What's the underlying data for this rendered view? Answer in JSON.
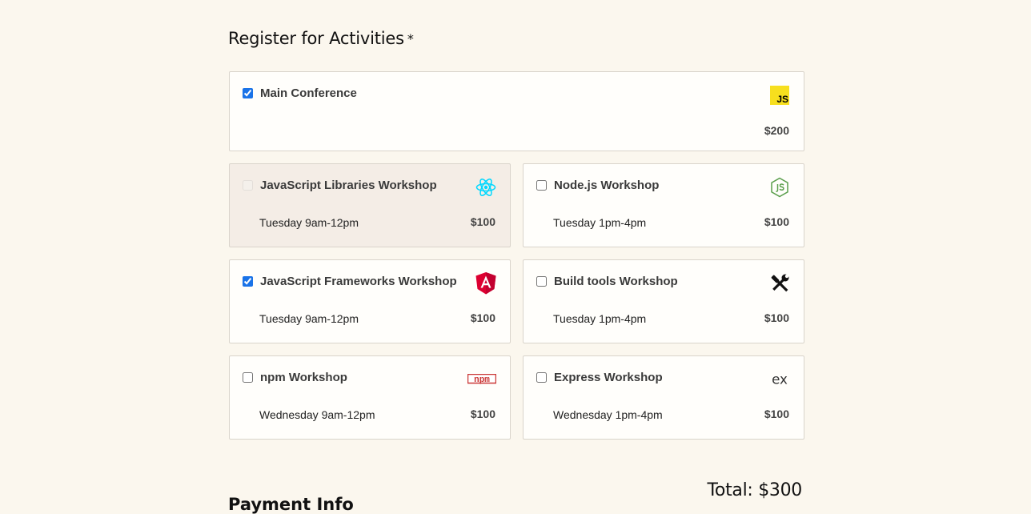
{
  "section": {
    "title": "Register for Activities",
    "required_mark": "*"
  },
  "activities": [
    {
      "name": "Main Conference",
      "time": "",
      "price": "$200",
      "checked": true,
      "disabled": false,
      "icon": "javascript-icon",
      "icon_text": "JS",
      "color": "#f7df1e"
    },
    {
      "name": "JavaScript Libraries Workshop",
      "time": "Tuesday 9am-12pm",
      "price": "$100",
      "checked": false,
      "disabled": true,
      "icon": "react-icon",
      "color": "#00d8ff"
    },
    {
      "name": "Node.js Workshop",
      "time": "Tuesday 1pm-4pm",
      "price": "$100",
      "checked": false,
      "disabled": false,
      "icon": "nodejs-icon",
      "color": "#5a9e4b"
    },
    {
      "name": "JavaScript Frameworks Workshop",
      "time": "Tuesday 9am-12pm",
      "price": "$100",
      "checked": true,
      "disabled": false,
      "icon": "angular-icon",
      "color": "#dd0031"
    },
    {
      "name": "Build tools Workshop",
      "time": "Tuesday 1pm-4pm",
      "price": "$100",
      "checked": false,
      "disabled": false,
      "icon": "tools-icon",
      "color": "#111111"
    },
    {
      "name": "npm Workshop",
      "time": "Wednesday 9am-12pm",
      "price": "$100",
      "checked": false,
      "disabled": false,
      "icon": "npm-icon",
      "icon_text": "npm",
      "color": "#cb3837"
    },
    {
      "name": "Express Workshop",
      "time": "Wednesday 1pm-4pm",
      "price": "$100",
      "checked": false,
      "disabled": false,
      "icon": "express-icon",
      "icon_text": "ex",
      "color": "#333333"
    }
  ],
  "total": {
    "label": "Total: $300"
  },
  "payment": {
    "title": "Payment Info"
  }
}
